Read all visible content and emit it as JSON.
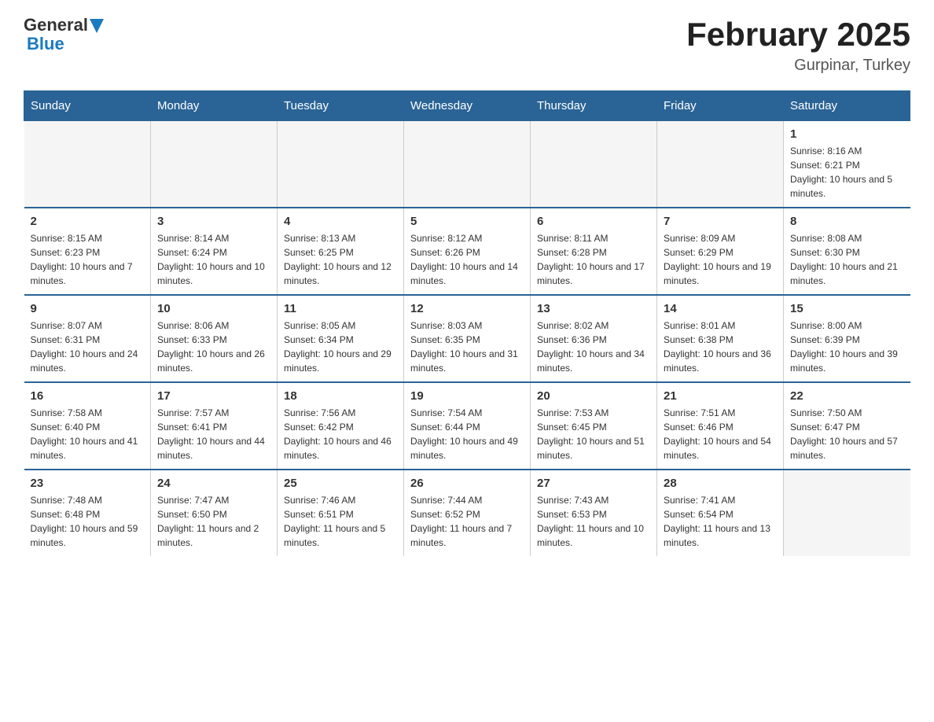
{
  "header": {
    "logo_general": "General",
    "logo_blue": "Blue",
    "title": "February 2025",
    "subtitle": "Gurpinar, Turkey"
  },
  "days_of_week": [
    "Sunday",
    "Monday",
    "Tuesday",
    "Wednesday",
    "Thursday",
    "Friday",
    "Saturday"
  ],
  "weeks": [
    [
      {
        "day": "",
        "info": ""
      },
      {
        "day": "",
        "info": ""
      },
      {
        "day": "",
        "info": ""
      },
      {
        "day": "",
        "info": ""
      },
      {
        "day": "",
        "info": ""
      },
      {
        "day": "",
        "info": ""
      },
      {
        "day": "1",
        "info": "Sunrise: 8:16 AM\nSunset: 6:21 PM\nDaylight: 10 hours and 5 minutes."
      }
    ],
    [
      {
        "day": "2",
        "info": "Sunrise: 8:15 AM\nSunset: 6:23 PM\nDaylight: 10 hours and 7 minutes."
      },
      {
        "day": "3",
        "info": "Sunrise: 8:14 AM\nSunset: 6:24 PM\nDaylight: 10 hours and 10 minutes."
      },
      {
        "day": "4",
        "info": "Sunrise: 8:13 AM\nSunset: 6:25 PM\nDaylight: 10 hours and 12 minutes."
      },
      {
        "day": "5",
        "info": "Sunrise: 8:12 AM\nSunset: 6:26 PM\nDaylight: 10 hours and 14 minutes."
      },
      {
        "day": "6",
        "info": "Sunrise: 8:11 AM\nSunset: 6:28 PM\nDaylight: 10 hours and 17 minutes."
      },
      {
        "day": "7",
        "info": "Sunrise: 8:09 AM\nSunset: 6:29 PM\nDaylight: 10 hours and 19 minutes."
      },
      {
        "day": "8",
        "info": "Sunrise: 8:08 AM\nSunset: 6:30 PM\nDaylight: 10 hours and 21 minutes."
      }
    ],
    [
      {
        "day": "9",
        "info": "Sunrise: 8:07 AM\nSunset: 6:31 PM\nDaylight: 10 hours and 24 minutes."
      },
      {
        "day": "10",
        "info": "Sunrise: 8:06 AM\nSunset: 6:33 PM\nDaylight: 10 hours and 26 minutes."
      },
      {
        "day": "11",
        "info": "Sunrise: 8:05 AM\nSunset: 6:34 PM\nDaylight: 10 hours and 29 minutes."
      },
      {
        "day": "12",
        "info": "Sunrise: 8:03 AM\nSunset: 6:35 PM\nDaylight: 10 hours and 31 minutes."
      },
      {
        "day": "13",
        "info": "Sunrise: 8:02 AM\nSunset: 6:36 PM\nDaylight: 10 hours and 34 minutes."
      },
      {
        "day": "14",
        "info": "Sunrise: 8:01 AM\nSunset: 6:38 PM\nDaylight: 10 hours and 36 minutes."
      },
      {
        "day": "15",
        "info": "Sunrise: 8:00 AM\nSunset: 6:39 PM\nDaylight: 10 hours and 39 minutes."
      }
    ],
    [
      {
        "day": "16",
        "info": "Sunrise: 7:58 AM\nSunset: 6:40 PM\nDaylight: 10 hours and 41 minutes."
      },
      {
        "day": "17",
        "info": "Sunrise: 7:57 AM\nSunset: 6:41 PM\nDaylight: 10 hours and 44 minutes."
      },
      {
        "day": "18",
        "info": "Sunrise: 7:56 AM\nSunset: 6:42 PM\nDaylight: 10 hours and 46 minutes."
      },
      {
        "day": "19",
        "info": "Sunrise: 7:54 AM\nSunset: 6:44 PM\nDaylight: 10 hours and 49 minutes."
      },
      {
        "day": "20",
        "info": "Sunrise: 7:53 AM\nSunset: 6:45 PM\nDaylight: 10 hours and 51 minutes."
      },
      {
        "day": "21",
        "info": "Sunrise: 7:51 AM\nSunset: 6:46 PM\nDaylight: 10 hours and 54 minutes."
      },
      {
        "day": "22",
        "info": "Sunrise: 7:50 AM\nSunset: 6:47 PM\nDaylight: 10 hours and 57 minutes."
      }
    ],
    [
      {
        "day": "23",
        "info": "Sunrise: 7:48 AM\nSunset: 6:48 PM\nDaylight: 10 hours and 59 minutes."
      },
      {
        "day": "24",
        "info": "Sunrise: 7:47 AM\nSunset: 6:50 PM\nDaylight: 11 hours and 2 minutes."
      },
      {
        "day": "25",
        "info": "Sunrise: 7:46 AM\nSunset: 6:51 PM\nDaylight: 11 hours and 5 minutes."
      },
      {
        "day": "26",
        "info": "Sunrise: 7:44 AM\nSunset: 6:52 PM\nDaylight: 11 hours and 7 minutes."
      },
      {
        "day": "27",
        "info": "Sunrise: 7:43 AM\nSunset: 6:53 PM\nDaylight: 11 hours and 10 minutes."
      },
      {
        "day": "28",
        "info": "Sunrise: 7:41 AM\nSunset: 6:54 PM\nDaylight: 11 hours and 13 minutes."
      },
      {
        "day": "",
        "info": ""
      }
    ]
  ]
}
